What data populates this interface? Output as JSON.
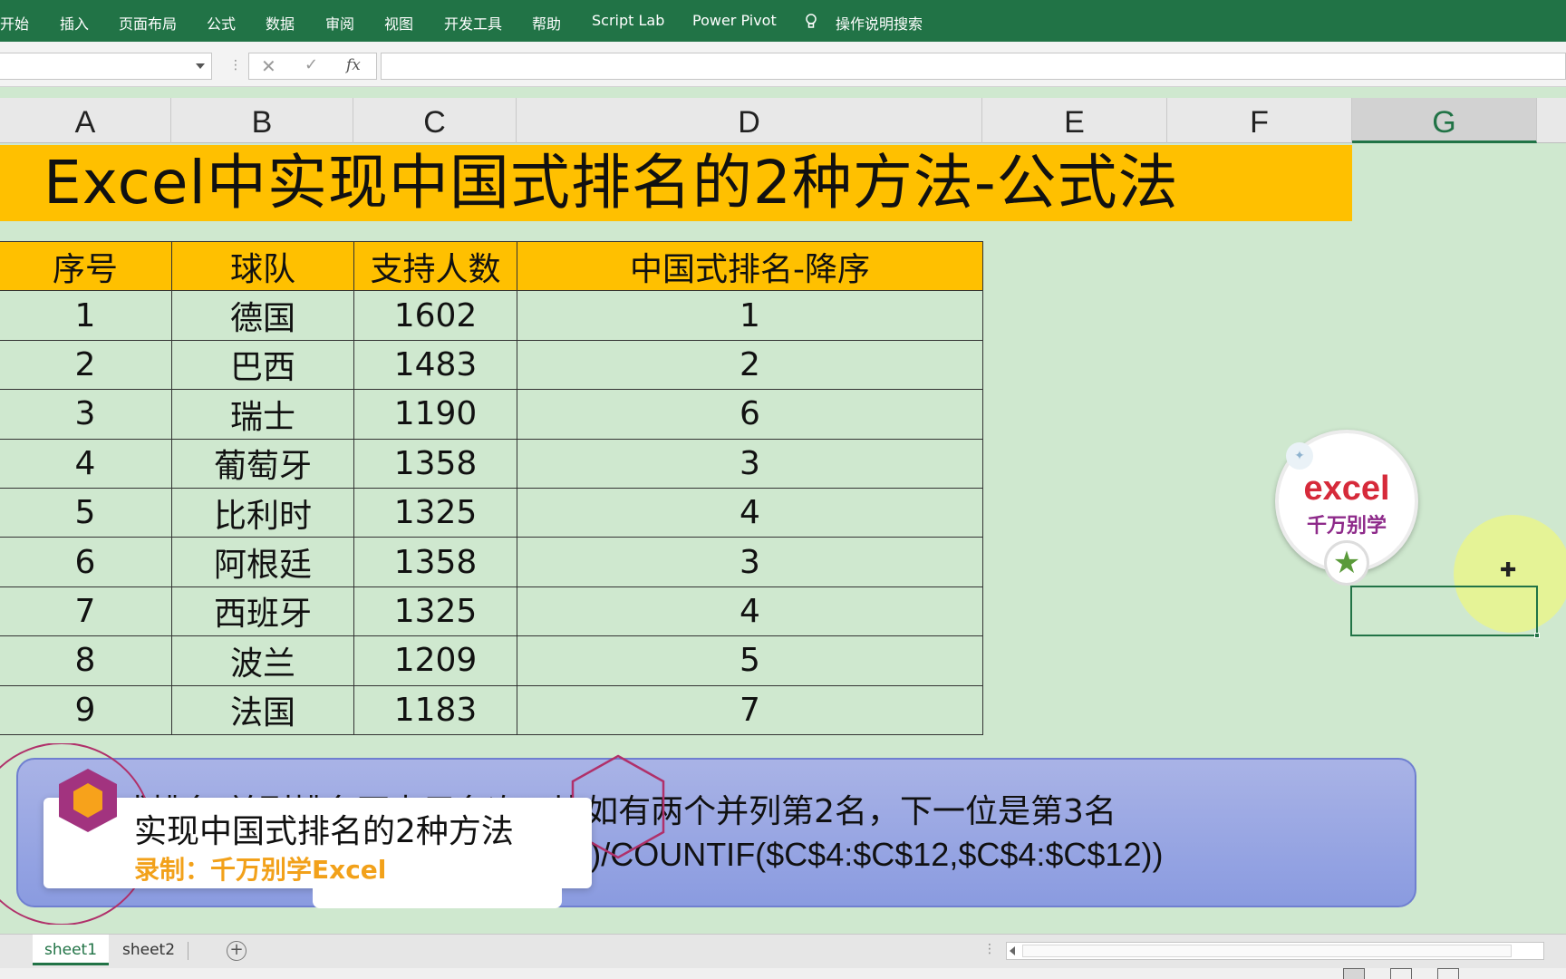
{
  "ribbon": {
    "tabs": [
      "开始",
      "插入",
      "页面布局",
      "公式",
      "数据",
      "审阅",
      "视图",
      "开发工具",
      "帮助",
      "Script Lab",
      "Power Pivot"
    ],
    "search_label": "操作说明搜索"
  },
  "formula_bar": {
    "fx_label": "fx",
    "cancel_label": "✕",
    "enter_label": "✓",
    "content": ""
  },
  "columns": [
    "A",
    "B",
    "C",
    "D",
    "E",
    "F",
    "G"
  ],
  "selected_column": "G",
  "title": "Excel中实现中国式排名的2种方法-公式法",
  "table": {
    "headers": [
      "序号",
      "球队",
      "支持人数",
      "中国式排名-降序"
    ],
    "rows": [
      [
        "1",
        "德国",
        "1602",
        "1"
      ],
      [
        "2",
        "巴西",
        "1483",
        "2"
      ],
      [
        "3",
        "瑞士",
        "1190",
        "6"
      ],
      [
        "4",
        "葡萄牙",
        "1358",
        "3"
      ],
      [
        "5",
        "比利时",
        "1325",
        "4"
      ],
      [
        "6",
        "阿根廷",
        "1358",
        "3"
      ],
      [
        "7",
        "西班牙",
        "1325",
        "4"
      ],
      [
        "8",
        "波兰",
        "1209",
        "5"
      ],
      [
        "9",
        "法国",
        "1183",
        "7"
      ]
    ]
  },
  "note": {
    "line1": "中国式排名:并列排名不占用名次，比如有两个并列第2名，下一位是第3名",
    "line2": "=SUMPRODUCT(($C$4:$C$12>=C4)/COUNTIF($C$4:$C$12,$C$4:$C$12))"
  },
  "logo": {
    "main": "excel",
    "sub": "千万别学"
  },
  "banner": {
    "title": "实现中国式排名的2种方法",
    "subtitle": "录制：千万别学Excel"
  },
  "sheets": [
    "sheet1",
    "sheet2"
  ],
  "active_sheet": "sheet1",
  "colors": {
    "excel_green": "#217346",
    "header_orange": "#ffc000",
    "sheet_bg": "#cfe8cf",
    "note_blue": "#8a9be0",
    "banner_accent": "#f2a11a"
  }
}
